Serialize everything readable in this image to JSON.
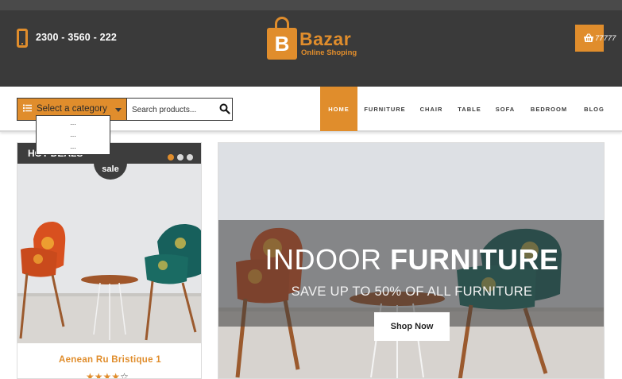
{
  "header": {
    "phone_number": "2300 - 3560 - 222",
    "logo_letter": "B",
    "logo_name": "Bazar",
    "logo_tagline": "Online Shoping",
    "cart_count": "77777"
  },
  "search_bar": {
    "category_label": "Select a category",
    "search_placeholder": "Search products...",
    "dropdown_options": [
      "...",
      "...",
      "..."
    ]
  },
  "nav": {
    "items": [
      {
        "label": "HOME",
        "active": true
      },
      {
        "label": "FURNITURE",
        "active": false
      },
      {
        "label": "CHAIR",
        "active": false
      },
      {
        "label": "TABLE",
        "active": false
      },
      {
        "label": "SOFA",
        "active": false
      },
      {
        "label": "BEDROOM",
        "active": false
      },
      {
        "label": "BLOG",
        "active": false
      }
    ]
  },
  "hot_deals": {
    "title": "HOT DEALS",
    "sale_badge": "sale",
    "product_title": "Aenean Ru Bristique 1",
    "rating": 4,
    "rating_max": 5,
    "carousel_dots": 3,
    "active_dot": 0
  },
  "banner": {
    "heading_thin": "INDOOR",
    "heading_bold": "FURNITURE",
    "subheading": "SAVE UP TO 50% OF ALL FURNITURE",
    "button_label": "Shop Now"
  },
  "colors": {
    "accent": "#e08d2c",
    "header_bg": "#3a3a3a",
    "topstrip_bg": "#4a4a4a"
  },
  "icons": [
    "phone-icon",
    "shopping-bag-logo-icon",
    "basket-icon",
    "list-icon",
    "caret-down-icon",
    "search-icon",
    "star-icon"
  ]
}
